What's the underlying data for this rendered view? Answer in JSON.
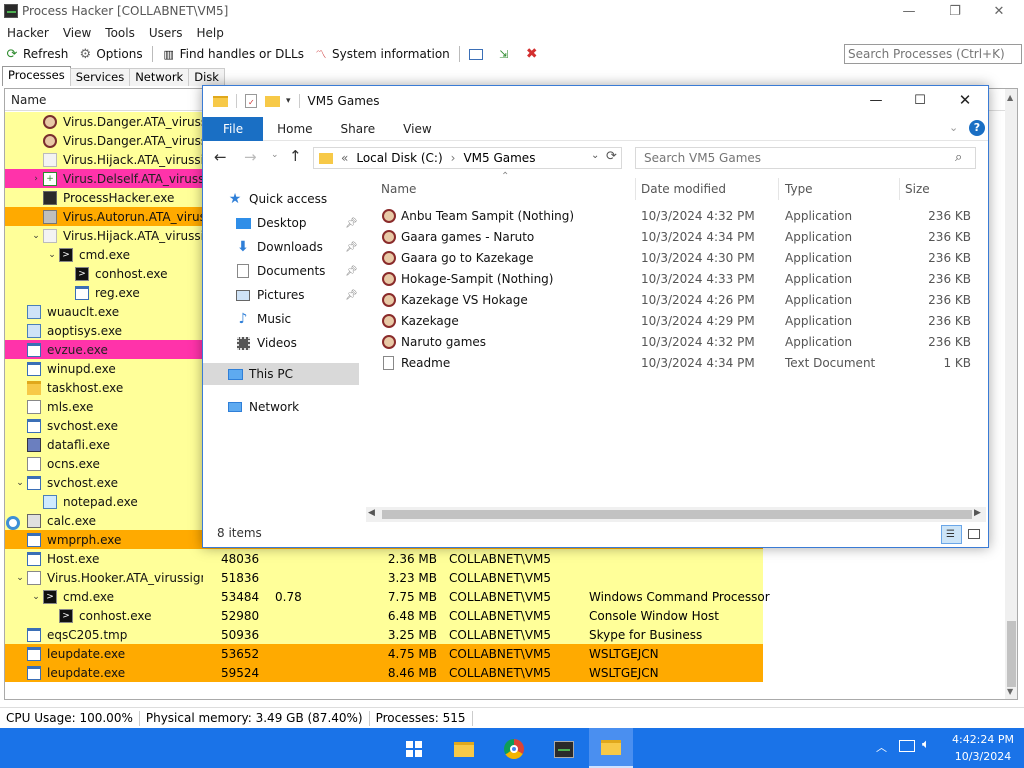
{
  "ph": {
    "title": "Process Hacker [COLLABNET\\VM5]",
    "menu": [
      "Hacker",
      "View",
      "Tools",
      "Users",
      "Help"
    ],
    "toolbar": {
      "refresh": "Refresh",
      "options": "Options",
      "find_handles": "Find handles or DLLs",
      "sysinfo": "System information"
    },
    "search_placeholder": "Search Processes (Ctrl+K)",
    "tabs": [
      "Processes",
      "Services",
      "Network",
      "Disk"
    ],
    "column_name": "Name",
    "rows": [
      {
        "name": "Virus.Danger.ATA_virussi...",
        "pid": "",
        "cpu": "",
        "mem": "",
        "user": "",
        "desc": "",
        "level": 2,
        "bg": "#ffff99",
        "icon": "face"
      },
      {
        "name": "Virus.Danger.ATA_virussi...",
        "pid": "",
        "cpu": "",
        "mem": "",
        "user": "",
        "desc": "",
        "level": 2,
        "bg": "#ffff99",
        "icon": "face"
      },
      {
        "name": "Virus.Hijack.ATA_virussi...",
        "pid": "",
        "cpu": "",
        "mem": "",
        "user": "",
        "desc": "",
        "level": 2,
        "bg": "#ffff99",
        "icon": "blank"
      },
      {
        "name": "Virus.Delself.ATA_virussi...",
        "pid": "",
        "cpu": "",
        "mem": "",
        "user": "",
        "desc": "",
        "level": 2,
        "bg": "#ff33aa",
        "icon": "plus",
        "expander": ">"
      },
      {
        "name": "ProcessHacker.exe",
        "pid": "",
        "cpu": "",
        "mem": "",
        "user": "",
        "desc": "",
        "level": 2,
        "bg": "#ffff99",
        "icon": "ph"
      },
      {
        "name": "Virus.Autorun.ATA_virus...",
        "pid": "",
        "cpu": "",
        "mem": "",
        "user": "",
        "desc": "",
        "level": 2,
        "bg": "#ffaa00",
        "icon": "drive"
      },
      {
        "name": "Virus.Hijack.ATA_virussi...",
        "pid": "",
        "cpu": "",
        "mem": "",
        "user": "",
        "desc": "",
        "level": 2,
        "bg": "#ffff99",
        "icon": "blank",
        "expander": "v"
      },
      {
        "name": "cmd.exe",
        "pid": "",
        "cpu": "",
        "mem": "",
        "user": "",
        "desc": "",
        "level": 3,
        "bg": "#ffff99",
        "icon": "cmd",
        "expander": "v"
      },
      {
        "name": "conhost.exe",
        "pid": "",
        "cpu": "",
        "mem": "",
        "user": "",
        "desc": "",
        "level": 4,
        "bg": "#ffff99",
        "icon": "cmd"
      },
      {
        "name": "reg.exe",
        "pid": "",
        "cpu": "",
        "mem": "",
        "user": "",
        "desc": "",
        "level": 4,
        "bg": "#ffff99",
        "icon": "win"
      },
      {
        "name": "wuauclt.exe",
        "pid": "",
        "cpu": "",
        "mem": "",
        "user": "",
        "desc": "",
        "level": 1,
        "bg": "#ffff99",
        "icon": "gear"
      },
      {
        "name": "aoptisys.exe",
        "pid": "",
        "cpu": "",
        "mem": "",
        "user": "",
        "desc": "",
        "level": 1,
        "bg": "#ffff99",
        "icon": "gear"
      },
      {
        "name": "evzue.exe",
        "pid": "",
        "cpu": "",
        "mem": "",
        "user": "",
        "desc": "",
        "level": 1,
        "bg": "#ff33aa",
        "icon": "win"
      },
      {
        "name": "winupd.exe",
        "pid": "",
        "cpu": "",
        "mem": "",
        "user": "",
        "desc": "",
        "level": 1,
        "bg": "#ffff99",
        "icon": "win"
      },
      {
        "name": "taskhost.exe",
        "pid": "",
        "cpu": "",
        "mem": "",
        "user": "",
        "desc": "",
        "level": 1,
        "bg": "#ffff99",
        "icon": "folder"
      },
      {
        "name": "mls.exe",
        "pid": "",
        "cpu": "",
        "mem": "",
        "user": "",
        "desc": "",
        "level": 1,
        "bg": "#ffff99",
        "icon": "doc"
      },
      {
        "name": "svchost.exe",
        "pid": "",
        "cpu": "",
        "mem": "",
        "user": "",
        "desc": "",
        "level": 1,
        "bg": "#ffff99",
        "icon": "win"
      },
      {
        "name": "datafli.exe",
        "pid": "",
        "cpu": "",
        "mem": "",
        "user": "",
        "desc": "",
        "level": 1,
        "bg": "#ffff99",
        "icon": "img"
      },
      {
        "name": "ocns.exe",
        "pid": "",
        "cpu": "",
        "mem": "",
        "user": "",
        "desc": "",
        "level": 1,
        "bg": "#ffff99",
        "icon": "doc"
      },
      {
        "name": "svchost.exe",
        "pid": "",
        "cpu": "",
        "mem": "",
        "user": "",
        "desc": "",
        "level": 1,
        "bg": "#ffff99",
        "icon": "win",
        "expander": "v"
      },
      {
        "name": "notepad.exe",
        "pid": "",
        "cpu": "",
        "mem": "",
        "user": "",
        "desc": "",
        "level": 2,
        "bg": "#ffff99",
        "icon": "notepad"
      },
      {
        "name": "calc.exe",
        "pid": "",
        "cpu": "",
        "mem": "",
        "user": "",
        "desc": "",
        "level": 1,
        "bg": "#ffff99",
        "icon": "calc"
      },
      {
        "name": "wmprph.exe",
        "pid": "",
        "cpu": "",
        "mem": "",
        "user": "",
        "desc": "",
        "level": 1,
        "bg": "#ffaa00",
        "icon": "win"
      },
      {
        "name": "Host.exe",
        "pid": "48036",
        "cpu": "",
        "mem": "2.36 MB",
        "user": "COLLABNET\\VM5",
        "desc": "",
        "level": 1,
        "bg": "#ffff99",
        "icon": "win"
      },
      {
        "name": "Virus.Hooker.ATA_virussign...",
        "pid": "51836",
        "cpu": "",
        "mem": "3.23 MB",
        "user": "COLLABNET\\VM5",
        "desc": "",
        "level": 1,
        "bg": "#ffff99",
        "icon": "doc",
        "expander": "v"
      },
      {
        "name": "cmd.exe",
        "pid": "53484",
        "cpu": "0.78",
        "mem": "7.75 MB",
        "user": "COLLABNET\\VM5",
        "desc": "Windows Command Processor",
        "level": 2,
        "bg": "#ffff99",
        "icon": "cmd",
        "expander": "v"
      },
      {
        "name": "conhost.exe",
        "pid": "52980",
        "cpu": "",
        "mem": "6.48 MB",
        "user": "COLLABNET\\VM5",
        "desc": "Console Window Host",
        "level": 3,
        "bg": "#ffff99",
        "icon": "cmd"
      },
      {
        "name": "eqsC205.tmp",
        "pid": "50936",
        "cpu": "",
        "mem": "3.25 MB",
        "user": "COLLABNET\\VM5",
        "desc": "Skype for Business",
        "level": 1,
        "bg": "#ffff99",
        "icon": "win"
      },
      {
        "name": "leupdate.exe",
        "pid": "53652",
        "cpu": "",
        "mem": "4.75 MB",
        "user": "COLLABNET\\VM5",
        "desc": "WSLTGEJCN",
        "level": 1,
        "bg": "#ffaa00",
        "icon": "win"
      },
      {
        "name": "leupdate.exe",
        "pid": "59524",
        "cpu": "",
        "mem": "8.46 MB",
        "user": "COLLABNET\\VM5",
        "desc": "WSLTGEJCN",
        "level": 1,
        "bg": "#ffaa00",
        "icon": "win"
      }
    ],
    "status": {
      "cpu": "CPU Usage: 100.00%",
      "mem": "Physical memory: 3.49 GB (87.40%)",
      "procs": "Processes: 515"
    }
  },
  "fe": {
    "title": "VM5 Games",
    "ribbon": [
      "File",
      "Home",
      "Share",
      "View"
    ],
    "address": [
      "Local Disk (C:)",
      "VM5 Games"
    ],
    "address_prefix": "«",
    "search_placeholder": "Search VM5 Games",
    "nav": {
      "quick_access": "Quick access",
      "desktop": "Desktop",
      "downloads": "Downloads",
      "documents": "Documents",
      "pictures": "Pictures",
      "music": "Music",
      "videos": "Videos",
      "this_pc": "This PC",
      "network": "Network"
    },
    "columns": {
      "name": "Name",
      "date": "Date modified",
      "type": "Type",
      "size": "Size"
    },
    "files": [
      {
        "name": "Anbu Team Sampit (Nothing)",
        "date": "10/3/2024 4:32 PM",
        "type": "Application",
        "size": "236 KB",
        "icon": "app"
      },
      {
        "name": "Gaara games - Naruto",
        "date": "10/3/2024 4:34 PM",
        "type": "Application",
        "size": "236 KB",
        "icon": "app"
      },
      {
        "name": "Gaara go to Kazekage",
        "date": "10/3/2024 4:30 PM",
        "type": "Application",
        "size": "236 KB",
        "icon": "app"
      },
      {
        "name": "Hokage-Sampit (Nothing)",
        "date": "10/3/2024 4:33 PM",
        "type": "Application",
        "size": "236 KB",
        "icon": "app"
      },
      {
        "name": "Kazekage VS Hokage",
        "date": "10/3/2024 4:26 PM",
        "type": "Application",
        "size": "236 KB",
        "icon": "app"
      },
      {
        "name": "Kazekage",
        "date": "10/3/2024 4:29 PM",
        "type": "Application",
        "size": "236 KB",
        "icon": "app"
      },
      {
        "name": "Naruto games",
        "date": "10/3/2024 4:32 PM",
        "type": "Application",
        "size": "236 KB",
        "icon": "app"
      },
      {
        "name": "Readme",
        "date": "10/3/2024 4:34 PM",
        "type": "Text Document",
        "size": "1 KB",
        "icon": "txt"
      }
    ],
    "status": "8 items"
  },
  "taskbar": {
    "time": "4:42:24 PM",
    "date": "10/3/2024"
  },
  "colors": {
    "taskbar": "#1a73e8",
    "yellow_row": "#ffff99",
    "pink_row": "#ff33aa",
    "orange_row": "#ffaa00",
    "file_tab": "#1a6fc4"
  }
}
